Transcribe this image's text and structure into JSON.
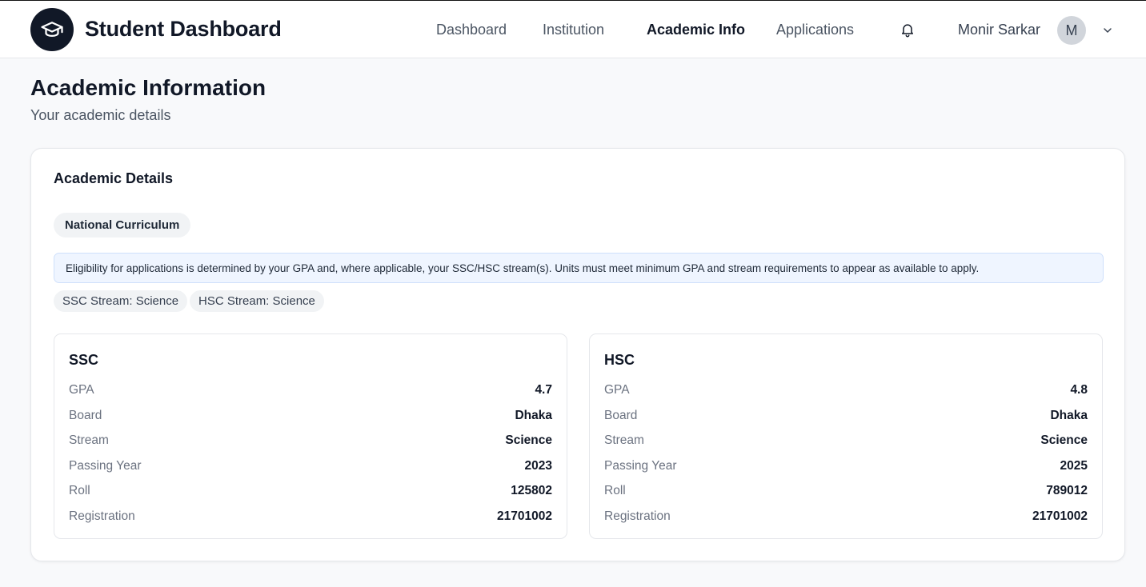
{
  "header": {
    "brand": "Student Dashboard",
    "nav": [
      {
        "label": "Dashboard"
      },
      {
        "label": "Institution"
      },
      {
        "label": "Academic Info"
      },
      {
        "label": "Applications"
      }
    ],
    "active_nav": "Academic Info",
    "user_name": "Monir Sarkar",
    "avatar_initial": "M",
    "icons": [
      "graduation-cap-icon",
      "bell-icon",
      "chevron-down-icon"
    ]
  },
  "page": {
    "title": "Academic Information",
    "subtitle": "Your academic details"
  },
  "card": {
    "title": "Academic Details",
    "curriculum": "National Curriculum",
    "notice": "Eligibility for applications is determined by your GPA and, where applicable, your SSC/HSC stream(s). Units must meet minimum GPA and stream requirements to appear as available to apply.",
    "streams": [
      "SSC Stream: Science",
      "HSC Stream: Science"
    ],
    "exams": [
      {
        "title": "SSC",
        "rows": [
          {
            "label": "GPA",
            "value": "4.7"
          },
          {
            "label": "Board",
            "value": "Dhaka"
          },
          {
            "label": "Stream",
            "value": "Science"
          },
          {
            "label": "Passing Year",
            "value": "2023"
          },
          {
            "label": "Roll",
            "value": "125802"
          },
          {
            "label": "Registration",
            "value": "21701002"
          }
        ]
      },
      {
        "title": "HSC",
        "rows": [
          {
            "label": "GPA",
            "value": "4.8"
          },
          {
            "label": "Board",
            "value": "Dhaka"
          },
          {
            "label": "Stream",
            "value": "Science"
          },
          {
            "label": "Passing Year",
            "value": "2025"
          },
          {
            "label": "Roll",
            "value": "789012"
          },
          {
            "label": "Registration",
            "value": "21701002"
          }
        ]
      }
    ]
  },
  "colors": {
    "primary": "#111827",
    "muted_text": "#6b7280",
    "background": "#f8f9fb",
    "notice_bg": "#eff5ff",
    "chip_bg": "#f1f3f5"
  }
}
